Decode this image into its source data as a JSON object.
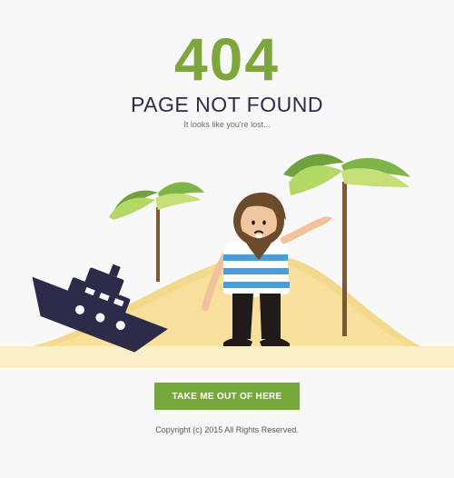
{
  "error_code": "404",
  "title": "PAGE NOT FOUND",
  "subtitle": "It looks like you're lost...",
  "cta": {
    "label": "TAKE ME OUT OF HERE"
  },
  "footer": {
    "copyright": "Copyright (c) 2015 All Rights Reserved."
  },
  "colors": {
    "accent": "#76a73a",
    "heading": "#2a2c49",
    "sand": "#f8df9c",
    "sky": "#f7f8f7"
  },
  "illustration": {
    "icons": [
      "shipwreck-icon",
      "palm-tree-icon",
      "castaway-character-icon",
      "sand-dune-icon"
    ]
  }
}
